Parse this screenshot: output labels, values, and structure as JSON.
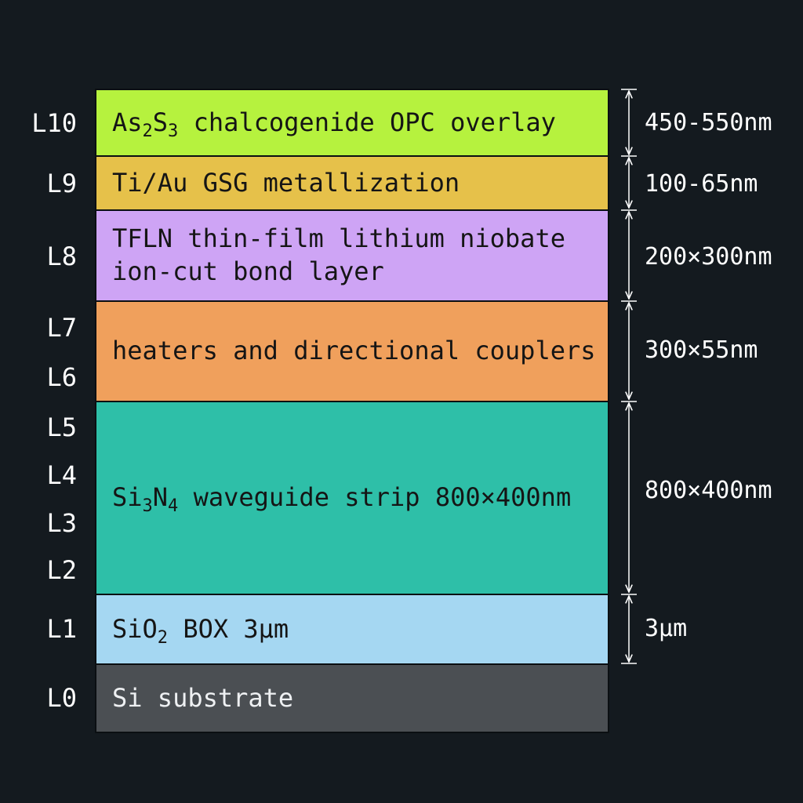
{
  "layers": [
    {
      "id": "L10",
      "parts": [
        "As",
        "2",
        "S",
        "3",
        " chalcogenide OPC overlay"
      ],
      "color": "#b6f23e",
      "dimension": "450-550nm"
    },
    {
      "id": "L9",
      "text": "Ti/Au GSG metallization",
      "color": "#e6c14a",
      "dimension": "100-65nm"
    },
    {
      "id": "L8",
      "line1": "TFLN thin-film lithium niobate",
      "line2": "ion-cut bond layer",
      "color": "#cea4f5",
      "dimension": "200×300nm"
    },
    {
      "ids": [
        "L7",
        "L6"
      ],
      "text": "heaters and directional couplers",
      "color": "#f0a05c",
      "dimension": "300×55nm"
    },
    {
      "ids": [
        "L5",
        "L4",
        "L3",
        "L2"
      ],
      "parts": [
        "Si",
        "3",
        "N",
        "4",
        " waveguide strip 800×400nm"
      ],
      "color": "#2ebfa8",
      "dimension": "800×400nm"
    },
    {
      "id": "L1",
      "parts": [
        "SiO",
        "2",
        " BOX 3μm"
      ],
      "color": "#a5d7f2",
      "dimension": "3μm"
    },
    {
      "id": "L0",
      "text": "Si substrate",
      "color": "#4b4f53"
    }
  ]
}
